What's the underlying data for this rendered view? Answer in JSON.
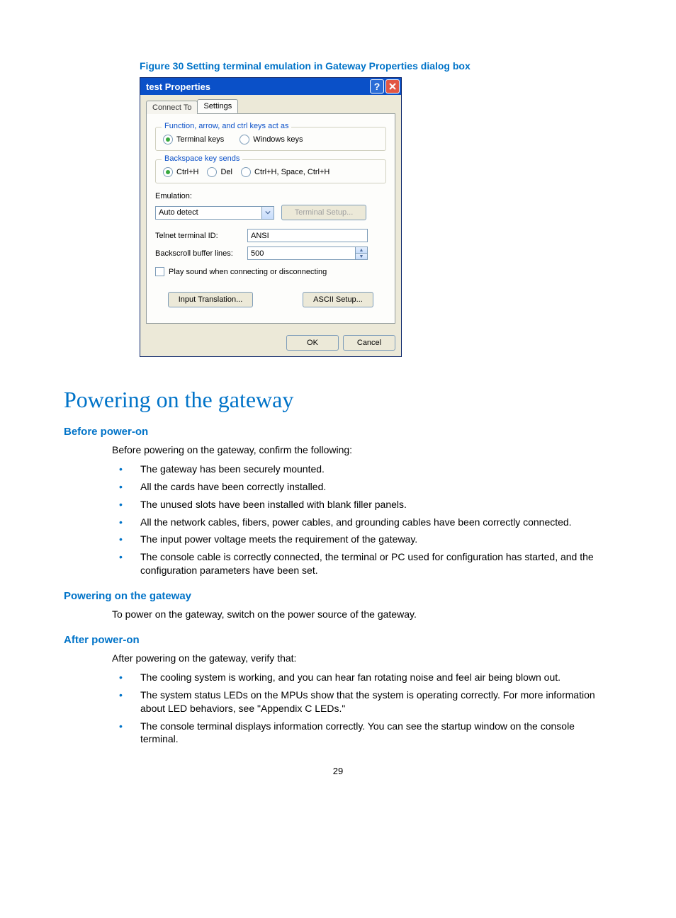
{
  "figure_caption": "Figure 30 Setting terminal emulation in Gateway Properties dialog box",
  "dialog": {
    "title": "test Properties",
    "tabs": {
      "inactive": "Connect To",
      "active": "Settings"
    },
    "group1": {
      "title": "Function, arrow, and ctrl keys act as",
      "opt1": "Terminal keys",
      "opt2": "Windows keys"
    },
    "group2": {
      "title": "Backspace key sends",
      "opt1": "Ctrl+H",
      "opt2": "Del",
      "opt3": "Ctrl+H, Space, Ctrl+H"
    },
    "emulation_label": "Emulation:",
    "emulation_value": "Auto detect",
    "terminal_setup": "Terminal Setup...",
    "telnet_label": "Telnet terminal ID:",
    "telnet_value": "ANSI",
    "backscroll_label": "Backscroll buffer lines:",
    "backscroll_value": "500",
    "play_sound": "Play sound when connecting or disconnecting",
    "input_translation": "Input Translation...",
    "ascii_setup": "ASCII Setup...",
    "ok": "OK",
    "cancel": "Cancel"
  },
  "h1": "Powering on the gateway",
  "sec1": {
    "heading": "Before power-on",
    "intro": "Before powering on the gateway, confirm the following:",
    "items": [
      "The gateway has been securely mounted.",
      "All the cards have been correctly installed.",
      "The unused slots have been installed with blank filler panels.",
      "All the network cables, fibers, power cables, and grounding cables have been correctly connected.",
      "The input power voltage meets the requirement of the gateway.",
      "The console cable is correctly connected, the terminal or PC used for configuration has started, and the configuration parameters have been set."
    ]
  },
  "sec2": {
    "heading": "Powering on the gateway",
    "body": "To power on the gateway, switch on the power source of the gateway."
  },
  "sec3": {
    "heading": "After power-on",
    "intro": "After powering on the gateway, verify that:",
    "items": [
      "The cooling system is working, and you can hear fan rotating noise and feel air being blown out.",
      "The system status LEDs on the MPUs show that the system is operating correctly. For more information about LED behaviors, see \"Appendix C LEDs.\"",
      "The console terminal displays information correctly. You can see the startup window on the console terminal."
    ]
  },
  "page_number": "29"
}
